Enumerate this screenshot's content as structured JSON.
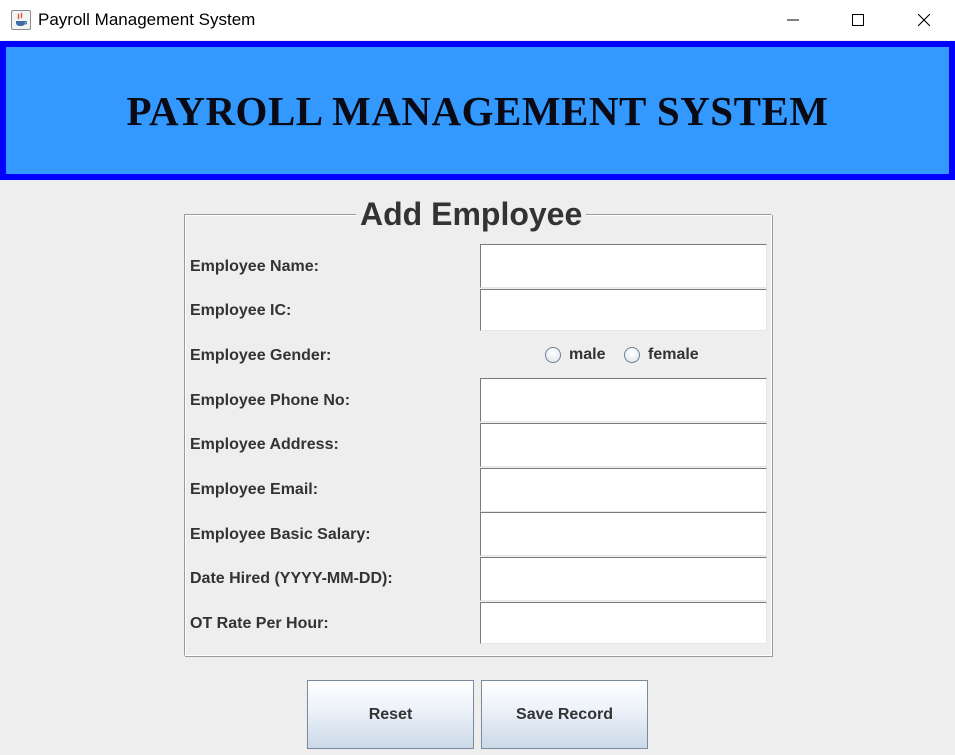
{
  "window": {
    "title": "Payroll Management System",
    "icon": "java-coffee-cup-icon",
    "controls": [
      "minimize-icon",
      "maximize-icon",
      "close-icon"
    ]
  },
  "banner": {
    "title": "PAYROLL MANAGEMENT SYSTEM",
    "background_color": "#3399ff",
    "border_color": "#0000ff"
  },
  "form": {
    "legend": "Add Employee",
    "labels": {
      "name": "Employee Name:",
      "ic": "Employee IC:",
      "gender": "Employee Gender:",
      "phone": "Employee Phone No:",
      "address": "Employee Address:",
      "email": "Employee Email:",
      "salary": "Employee Basic Salary:",
      "date_hired": "Date Hired (YYYY-MM-DD):",
      "ot_rate": "OT Rate Per Hour:"
    },
    "values": {
      "name": "",
      "ic": "",
      "phone": "",
      "address": "",
      "email": "",
      "salary": "",
      "date_hired": "",
      "ot_rate": ""
    },
    "gender_options": {
      "male": "male",
      "female": "female"
    }
  },
  "buttons": {
    "reset": "Reset",
    "save": "Save Record"
  }
}
